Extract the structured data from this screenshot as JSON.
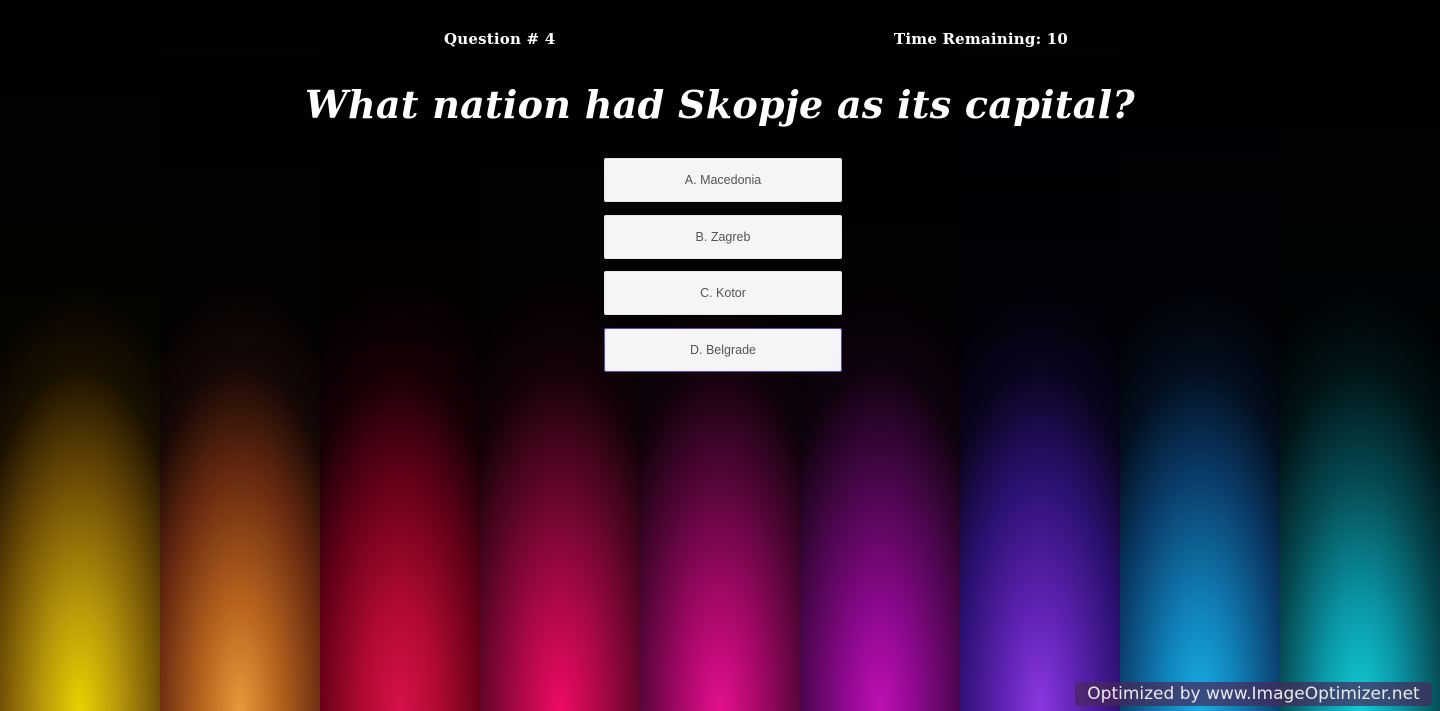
{
  "header": {
    "question_number": "Question # 4",
    "time_remaining": "Time Remaining: 10"
  },
  "question": {
    "text": "What nation had Skopje as its capital?"
  },
  "answers": [
    {
      "label": "A. Macedonia"
    },
    {
      "label": "B. Zagreb"
    },
    {
      "label": "C. Kotor"
    },
    {
      "label": "D. Belgrade"
    }
  ],
  "watermark": {
    "text": "Optimized by www.ImageOptimizer.net"
  },
  "colors": {
    "stripes": [
      "#e8d200",
      "#e89a3a",
      "#d8104a",
      "#ee0a64",
      "#e4108c",
      "#c010b4",
      "#8c38e0",
      "#18b0e4",
      "#14ccd6"
    ],
    "button_background": "#f5f5f5",
    "button_text": "#555555",
    "hover_border": "#5a4ad0",
    "heading_text": "#ffffff"
  }
}
